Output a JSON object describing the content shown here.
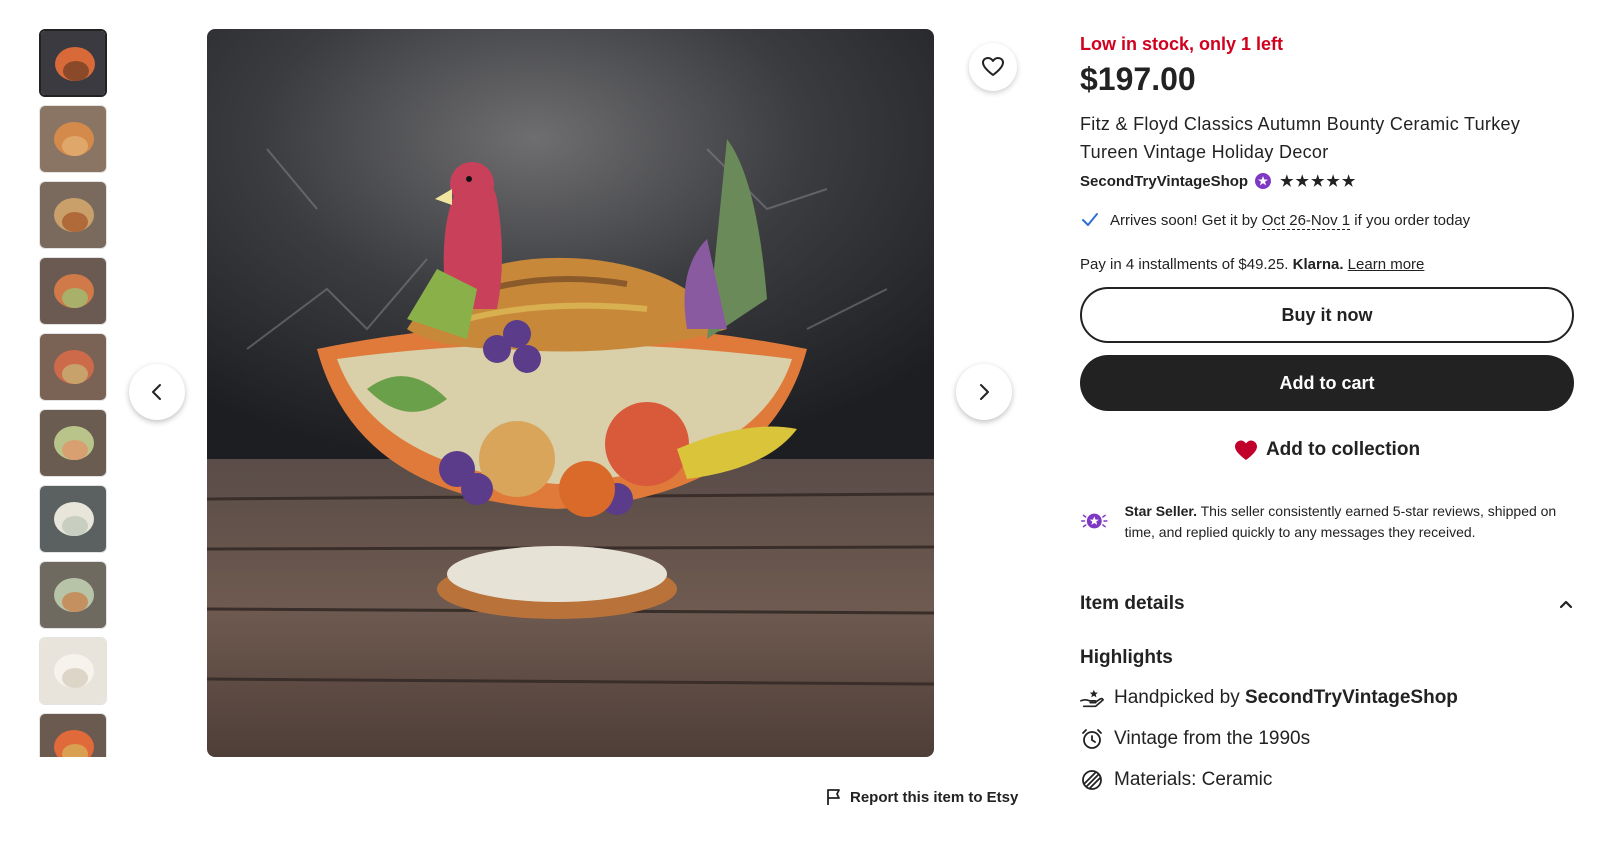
{
  "colors": {
    "accent_red": "#d1001f",
    "text": "#222222",
    "star_purple": "#7f38c4",
    "heart": "#c0002a"
  },
  "thumbnails": [
    {
      "bg": "#3a3a40",
      "c1": "#d86a3a",
      "c2": "#8a4a2a"
    },
    {
      "bg": "#8a7565",
      "c1": "#d48a4a",
      "c2": "#e0a76a"
    },
    {
      "bg": "#7a6a5e",
      "c1": "#caa06a",
      "c2": "#b06a3a"
    },
    {
      "bg": "#6a5a52",
      "c1": "#d07a4a",
      "c2": "#a8b06a"
    },
    {
      "bg": "#7a6355",
      "c1": "#cc6a4a",
      "c2": "#c7a36b"
    },
    {
      "bg": "#6a5c50",
      "c1": "#b9c48a",
      "c2": "#d8a070"
    },
    {
      "bg": "#5b6060",
      "c1": "#e8e6da",
      "c2": "#c9cfc0"
    },
    {
      "bg": "#6f6a60",
      "c1": "#b8c4a8",
      "c2": "#c49060"
    },
    {
      "bg": "#e8e4dc",
      "c1": "#f6f3ed",
      "c2": "#ddd5c8"
    },
    {
      "bg": "#6a5a4f",
      "c1": "#e06a3a",
      "c2": "#d8a050"
    }
  ],
  "main_image": {
    "alt_name": "turkey-tureen-photo"
  },
  "report_label": "Report this item to Etsy",
  "stock_text": "Low in stock, only 1 left",
  "price": "$197.00",
  "title": "Fitz & Floyd Classics Autumn Bounty Ceramic Turkey Tureen Vintage Holiday Decor",
  "shop_name": "SecondTryVintageShop",
  "rating_stars": "★★★★★",
  "rating_value": 5,
  "arrival": {
    "prefix": "Arrives soon! Get it by",
    "date": "Oct 26-Nov 1",
    "suffix": "if you order today"
  },
  "klarna": {
    "text": "Pay in 4 installments of $49.25.",
    "brand": "Klarna.",
    "link": "Learn more"
  },
  "buttons": {
    "buy_now": "Buy it now",
    "add_to_cart": "Add to cart",
    "add_to_collection": "Add to collection"
  },
  "star_seller": {
    "title": "Star Seller.",
    "text": "This seller consistently earned 5-star reviews, shipped on time, and replied quickly to any messages they received."
  },
  "item_details_label": "Item details",
  "highlights": {
    "heading": "Highlights",
    "handpicked_prefix": "Handpicked by",
    "handpicked_shop": "SecondTryVintageShop",
    "vintage": "Vintage from the 1990s",
    "materials": "Materials: Ceramic"
  }
}
